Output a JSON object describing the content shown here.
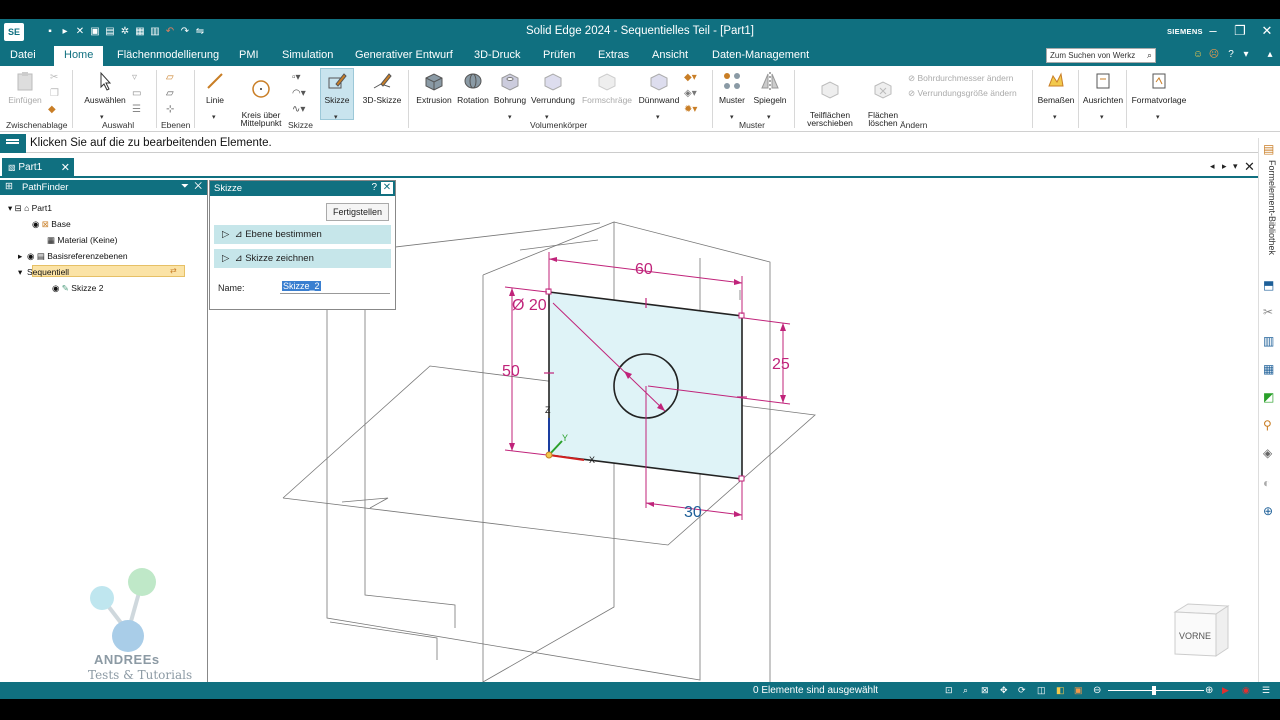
{
  "window": {
    "app_logo": "SE",
    "title": "Solid Edge 2024 - Sequentielles Teil - [Part1]",
    "brand": "SIEMENS"
  },
  "menu": {
    "items": [
      "Datei",
      "Home",
      "Flächenmodellierung",
      "PMI",
      "Simulation",
      "Generativer Entwurf",
      "3D-Druck",
      "Prüfen",
      "Extras",
      "Ansicht",
      "Daten-Management"
    ],
    "active": "Home",
    "search_placeholder": "Zum Suchen von Werkz"
  },
  "ribbon": {
    "clipboard": {
      "paste": "Einfügen",
      "group": "Zwischenablage"
    },
    "select": {
      "select": "Auswählen",
      "group": "Auswahl"
    },
    "planes": {
      "group": "Ebenen"
    },
    "sketch": {
      "line": "Linie",
      "circle": "Kreis über\nMittelpunkt",
      "sketch": "Skizze",
      "sketch3d": "3D-Skizze",
      "group": "Skizze"
    },
    "solids": {
      "extrude": "Extrusion",
      "revolve": "Rotation",
      "hole": "Bohrung",
      "round": "Verrundung",
      "draft": "Formschräge",
      "thin": "Dünnwand",
      "group": "Volumenkörper"
    },
    "pattern": {
      "pattern": "Muster",
      "mirror": "Spiegeln",
      "group": "Muster"
    },
    "modify": {
      "move_faces": "Teilflächen\nverschieben",
      "delete_faces": "Flächen\nlöschen",
      "hole_diam": "Bohrdurchmesser ändern",
      "round_size": "Verrundungsgröße ändern",
      "group": "Ändern"
    },
    "dims": {
      "dimension": "Bemaßen",
      "align": "Ausrichten",
      "format": "Formatvorlage"
    }
  },
  "prompt": {
    "text": "Klicken Sie auf die zu bearbeitenden Elemente."
  },
  "doc_tab": {
    "label": "Part1"
  },
  "pathfinder": {
    "title": "PathFinder",
    "items": [
      "Part1",
      "Base",
      "Material (Keine)",
      "Basisreferenzebenen",
      "Sequentiell",
      "Skizze 2"
    ]
  },
  "skizze_panel": {
    "title": "Skizze",
    "finish": "Fertigstellen",
    "step1": "Ebene bestimmen",
    "step2": "Skizze zeichnen",
    "name_label": "Name:",
    "name_value": "Skizze_2"
  },
  "sketch": {
    "dim_width": "60",
    "dim_height": "50",
    "dim_diameter": "Ø 20",
    "dim_circle_y": "25",
    "dim_circle_x": "30",
    "axis_x": "X",
    "axis_y": "Y",
    "axis_z": "Z"
  },
  "viewcube": {
    "label": "VORNE"
  },
  "rightbar": {
    "library": "Formelement-Bibliothek"
  },
  "status": {
    "text": "0 Elemente sind ausgewählt"
  },
  "watermark": {
    "line1": "ANDREEs",
    "line2": "Tests & Tutorials"
  },
  "colors": {
    "accent": "#107080",
    "dimension": "#c0237a",
    "sketch_fill": "#dff3f7"
  }
}
